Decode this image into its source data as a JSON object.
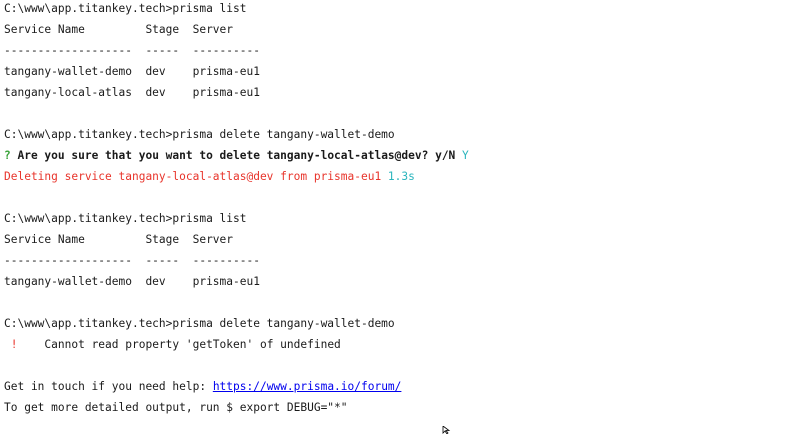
{
  "terminal": {
    "lines": [
      {
        "text": "C:\\www\\app.titankey.tech>prisma list"
      },
      {
        "text": "Service Name         Stage  Server"
      },
      {
        "text": "-------------------  -----  ----------"
      },
      {
        "text": "tangany-wallet-demo  dev    prisma-eu1"
      },
      {
        "text": "tangany-local-atlas  dev    prisma-eu1"
      },
      {
        "text": ""
      },
      {
        "text": "C:\\www\\app.titankey.tech>prisma delete tangany-wallet-demo"
      },
      {
        "prefix": "?",
        "text": " Are you sure that you want to delete tangany-local-atlas@dev? y/N ",
        "answer": "Y"
      },
      {
        "text": "Deleting service tangany-local-atlas@dev from prisma-eu1 ",
        "timing": "1.3s"
      },
      {
        "text": ""
      },
      {
        "text": "C:\\www\\app.titankey.tech>prisma list"
      },
      {
        "text": "Service Name         Stage  Server"
      },
      {
        "text": "-------------------  -----  ----------"
      },
      {
        "text": "tangany-wallet-demo  dev    prisma-eu1"
      },
      {
        "text": ""
      },
      {
        "text": "C:\\www\\app.titankey.tech>prisma delete tangany-wallet-demo"
      },
      {
        "prefix": " !",
        "text": "    Cannot read property 'getToken' of undefined"
      },
      {
        "text": ""
      },
      {
        "text": "Get in touch if you need help: ",
        "link": "https://www.prisma.io/forum/"
      },
      {
        "text": "To get more detailed output, run $ export DEBUG=\"*\""
      }
    ]
  },
  "colors": {
    "background": "#ffffff",
    "text": "#1a1a1a",
    "error": "#e8342b",
    "prompt_answer": "#2bb5bd",
    "question_mark": "#3aa33a",
    "link": "#0000ee"
  },
  "cursor": {
    "icon": "mouse-pointer-icon"
  }
}
